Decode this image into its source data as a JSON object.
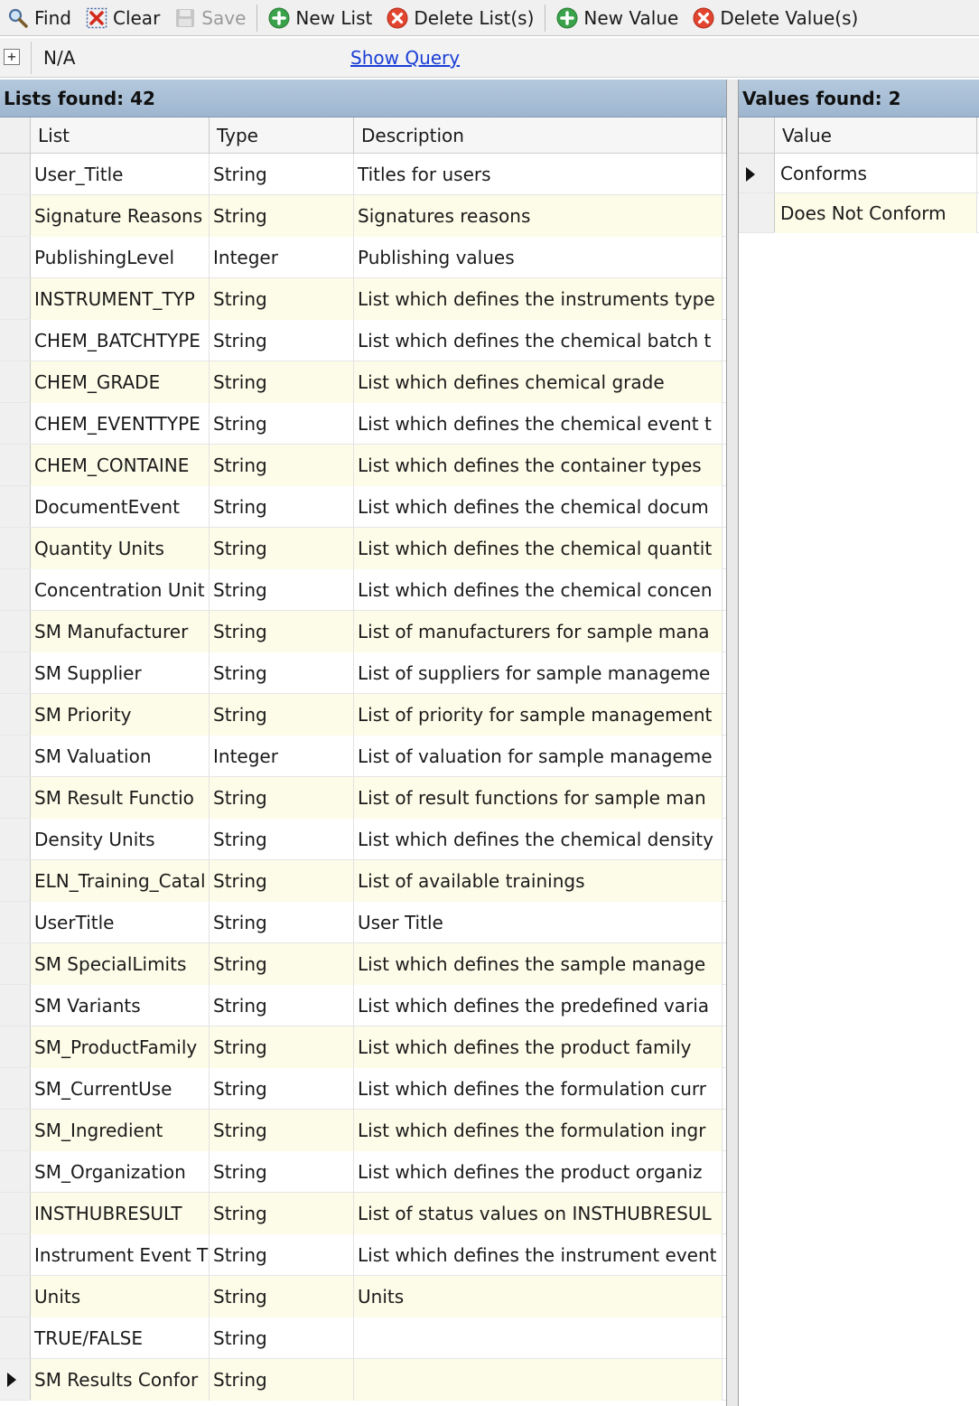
{
  "toolbar": {
    "find": "Find",
    "clear": "Clear",
    "save": "Save",
    "new_list": "New List",
    "delete_lists": "Delete List(s)",
    "new_value": "New Value",
    "delete_values": "Delete Value(s)"
  },
  "query": {
    "expander": "+",
    "value": "N/A",
    "show_query": "Show Query"
  },
  "lists_panel": {
    "title": "Lists found: 42",
    "columns": {
      "list": "List",
      "type": "Type",
      "description": "Description"
    },
    "rows": [
      {
        "list": "User_Title",
        "type": "String",
        "description": "Titles for users"
      },
      {
        "list": "Signature Reasons",
        "type": "String",
        "description": "Signatures reasons"
      },
      {
        "list": "PublishingLevel",
        "type": "Integer",
        "description": "Publishing values"
      },
      {
        "list": "INSTRUMENT_TYP",
        "type": "String",
        "description": "List which defines the instruments type"
      },
      {
        "list": "CHEM_BATCHTYPE",
        "type": "String",
        "description": "List which defines the chemical batch t"
      },
      {
        "list": "CHEM_GRADE",
        "type": "String",
        "description": "List which defines chemical grade"
      },
      {
        "list": "CHEM_EVENTTYPE",
        "type": "String",
        "description": "List which defines the chemical event t"
      },
      {
        "list": "CHEM_CONTAINE",
        "type": "String",
        "description": "List which defines the container types"
      },
      {
        "list": "DocumentEvent",
        "type": "String",
        "description": "List which defines the chemical docum"
      },
      {
        "list": "Quantity Units",
        "type": "String",
        "description": "List which defines the chemical quantit"
      },
      {
        "list": "Concentration Unit",
        "type": "String",
        "description": "List which defines the chemical concen"
      },
      {
        "list": "SM Manufacturer",
        "type": "String",
        "description": "List of manufacturers for sample mana"
      },
      {
        "list": "SM Supplier",
        "type": "String",
        "description": "List of suppliers for sample manageme"
      },
      {
        "list": "SM Priority",
        "type": "String",
        "description": "List of priority for sample management"
      },
      {
        "list": "SM Valuation",
        "type": "Integer",
        "description": "List of valuation for sample manageme"
      },
      {
        "list": "SM Result Functio",
        "type": "String",
        "description": "List of result functions for sample man"
      },
      {
        "list": "Density Units",
        "type": "String",
        "description": "List which defines the chemical density"
      },
      {
        "list": "ELN_Training_Catal",
        "type": "String",
        "description": "List of available trainings"
      },
      {
        "list": "UserTitle",
        "type": "String",
        "description": "User Title"
      },
      {
        "list": "SM SpecialLimits",
        "type": "String",
        "description": "List which defines the sample manage"
      },
      {
        "list": "SM Variants",
        "type": "String",
        "description": "List which defines the predefined varia"
      },
      {
        "list": "SM_ProductFamily",
        "type": "String",
        "description": "List which defines the product family"
      },
      {
        "list": "SM_CurrentUse",
        "type": "String",
        "description": "List which defines the formulation curr"
      },
      {
        "list": "SM_Ingredient",
        "type": "String",
        "description": "List which defines the formulation ingr"
      },
      {
        "list": "SM_Organization",
        "type": "String",
        "description": "List which defines the product organiz"
      },
      {
        "list": "INSTHUBRESULT",
        "type": "String",
        "description": "List of status values on INSTHUBRESUL"
      },
      {
        "list": "Instrument Event T",
        "type": "String",
        "description": "List which defines the instrument event"
      },
      {
        "list": "Units",
        "type": "String",
        "description": "Units"
      },
      {
        "list": "TRUE/FALSE",
        "type": "String",
        "description": ""
      },
      {
        "list": "SM Results Confor",
        "type": "String",
        "description": "",
        "current": true
      }
    ]
  },
  "values_panel": {
    "title": "Values found: 2",
    "columns": {
      "value": "Value"
    },
    "rows": [
      {
        "value": "Conforms",
        "current": true
      },
      {
        "value": "Does Not Conform"
      }
    ]
  },
  "colors": {
    "header_blue": "#a9bfd6",
    "alt_row": "#fdfce8",
    "link": "#1a3fd6"
  },
  "icons": {
    "find": "magnifier-icon",
    "clear": "clear-x-icon",
    "save": "floppy-icon",
    "new": "green-plus-circle-icon",
    "delete": "red-x-circle-icon"
  }
}
